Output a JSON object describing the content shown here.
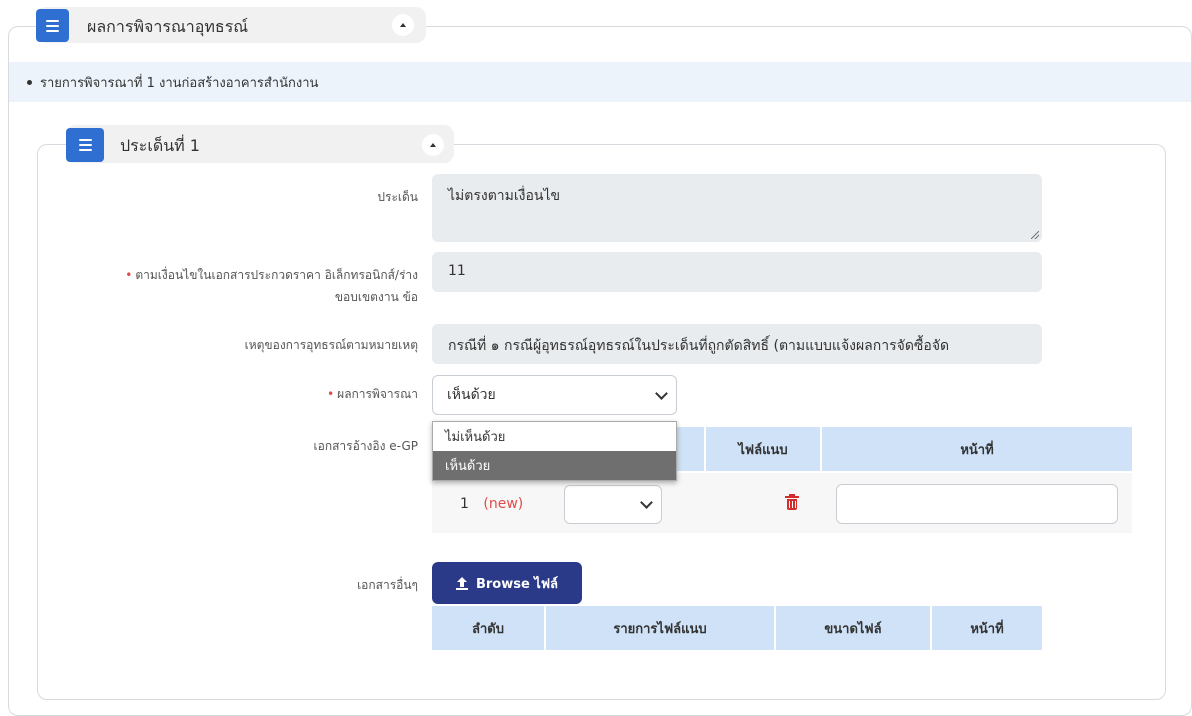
{
  "outer": {
    "title": "ผลการพิจารณาอุทธรณ์",
    "item_text": "รายการพิจารณาที่ 1 งานก่อสร้างอาคารสำนักงาน"
  },
  "inner": {
    "title": "ประเด็นที่ 1"
  },
  "form": {
    "issue_label": "ประเด็น",
    "issue_value": "ไม่ตรงตามเงื่อนไข",
    "condition_label_line1": "ตามเงื่อนไขในเอกสารประกวดราคา อิเล็กทรอนิกส์/ร่าง",
    "condition_label_line2": "ขอบเขตงาน ข้อ",
    "condition_value": "11",
    "reason_label": "เหตุของการอุทธรณ์ตามหมายเหตุ",
    "reason_value": "กรณีที่ ๑ กรณีผู้อุทธรณ์อุทธรณ์ในประเด็นที่ถูกตัดสิทธิ์ (ตามแบบแจ้งผลการจัดซื้อจัด",
    "result_label": "ผลการพิจารณา",
    "result_value": "เห็นด้วย",
    "result_options": [
      "ไม่เห็นด้วย",
      "เห็นด้วย"
    ],
    "ref_doc_label": "เอกสารอ้างอิง e-GP",
    "other_doc_label": "เอกสารอื่นๆ",
    "browse_label": "Browse ไฟล์"
  },
  "ref_table": {
    "headers": [
      "ไฟล์แนบ",
      "หน้าที่"
    ],
    "row": {
      "index": "1",
      "new_tag": "(new)",
      "page_value": ""
    }
  },
  "file_table": {
    "headers": [
      "ลำดับ",
      "รายการไฟล์แนบ",
      "ขนาดไฟล์",
      "หน้าที่"
    ]
  },
  "colors": {
    "accent": "#2f6fd1",
    "header_bg": "#f1f1f1",
    "band_bg": "#edf3fb",
    "table_header": "#cfe2f7",
    "button": "#2a3a88",
    "required": "#e04b4b",
    "delete": "#d42b2b"
  },
  "icons": [
    "menu-icon",
    "caret-up-icon",
    "chevron-down-icon",
    "trash-icon",
    "upload-icon"
  ]
}
